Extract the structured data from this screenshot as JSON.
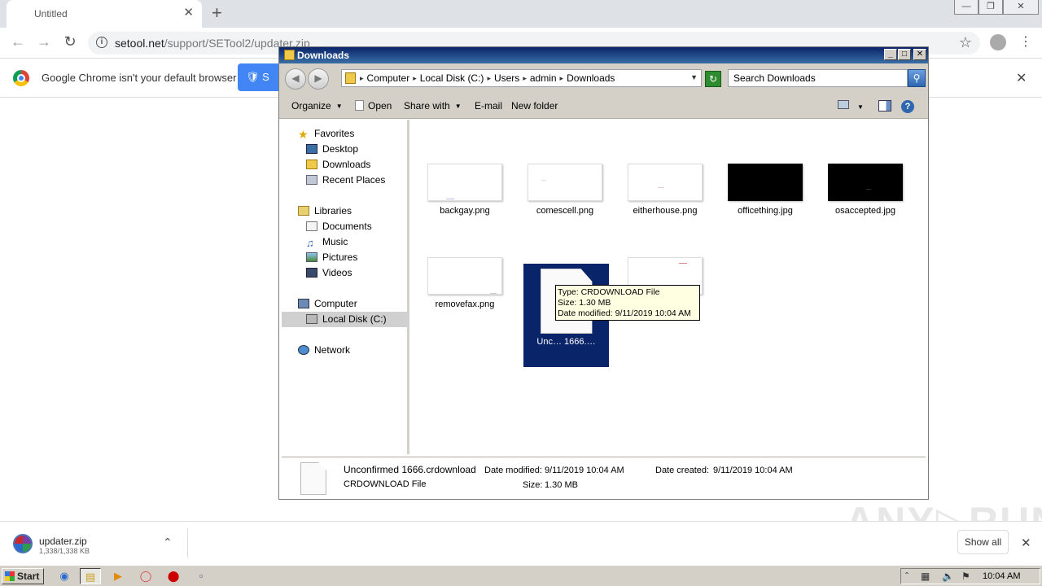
{
  "browser": {
    "tab_title": "Untitled",
    "tab_close": "✕",
    "new_tab": "+",
    "window_buttons": [
      "—",
      "❐",
      "✕"
    ],
    "url_host": "setool.net",
    "url_path": "/support/SETool2/updater.zip",
    "infobar_text": "Google Chrome isn't your default browser",
    "infobar_button": "S",
    "infobar_close": "✕"
  },
  "explorer": {
    "title": "Downloads",
    "window_buttons": [
      "_",
      "□",
      "✕"
    ],
    "breadcrumbs": [
      "Computer",
      "Local Disk (C:)",
      "Users",
      "admin",
      "Downloads"
    ],
    "search_placeholder": "Search Downloads",
    "toolbar": {
      "organize": "Organize",
      "open": "Open",
      "share_with": "Share with",
      "email": "E-mail",
      "new_folder": "New folder"
    },
    "nav": {
      "favorites": "Favorites",
      "desktop": "Desktop",
      "downloads": "Downloads",
      "recent_places": "Recent Places",
      "libraries": "Libraries",
      "documents": "Documents",
      "music": "Music",
      "pictures": "Pictures",
      "videos": "Videos",
      "computer": "Computer",
      "local_disk": "Local Disk (C:)",
      "network": "Network"
    },
    "files": [
      {
        "name": "backgay.png"
      },
      {
        "name": "comescell.png"
      },
      {
        "name": "eitherhouse.png"
      },
      {
        "name": "officething.jpg"
      },
      {
        "name": "osaccepted.jpg"
      },
      {
        "name": "removefax.png"
      },
      {
        "name": "Unc… 1666.…"
      }
    ],
    "tooltip": {
      "type": "Type: CRDOWNLOAD File",
      "size": "Size: 1.30 MB",
      "date": "Date modified: 9/11/2019 10:04 AM"
    },
    "details": {
      "filename": "Unconfirmed 1666.crdownload",
      "type": "CRDOWNLOAD File",
      "date_modified_label": "Date modified:",
      "date_modified": "9/11/2019 10:04 AM",
      "date_created_label": "Date created:",
      "date_created": "9/11/2019 10:04 AM",
      "size_label": "Size:",
      "size": "1.30 MB"
    }
  },
  "downloads_shelf": {
    "filename": "updater.zip",
    "progress": "1,338/1,338 KB",
    "show_all": "Show all",
    "close": "✕"
  },
  "watermark": "ANY▷RUN",
  "taskbar": {
    "start": "Start",
    "clock": "10:04 AM"
  }
}
